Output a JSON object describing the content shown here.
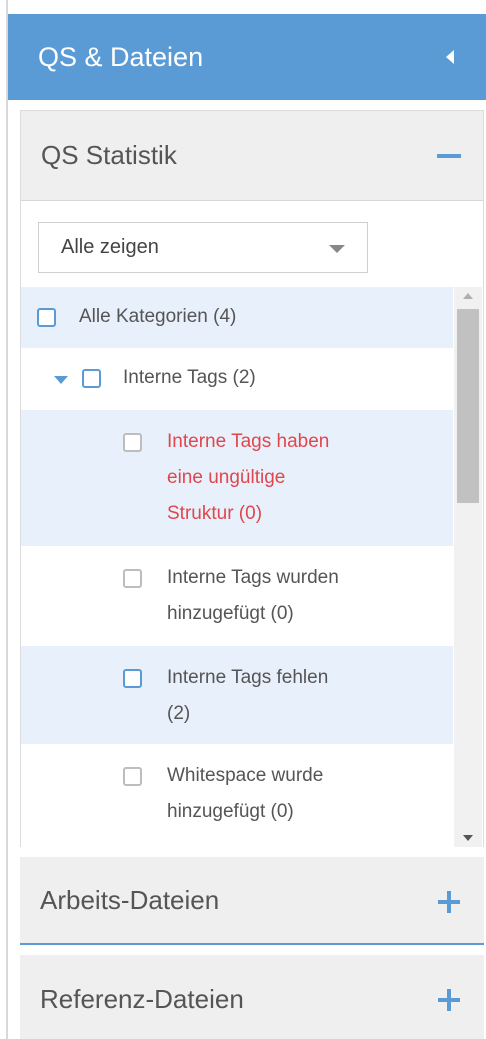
{
  "header": {
    "title": "QS & Dateien"
  },
  "qs_statistik": {
    "title": "QS Statistik",
    "filter": {
      "selected": "Alle zeigen"
    },
    "tree": {
      "root": {
        "label": "Alle Kategorien (4)"
      },
      "group": {
        "label": "Interne Tags (2)"
      },
      "children": [
        {
          "line1": "Interne Tags haben",
          "line2": "eine ungültige",
          "line3": "Struktur (0)"
        },
        {
          "line1": "Interne Tags wurden",
          "line2": "hinzugefügt (0)"
        },
        {
          "line1": "Interne Tags fehlen",
          "line2": "(2)"
        },
        {
          "line1": "Whitespace wurde",
          "line2": "hinzugefügt (0)"
        }
      ]
    }
  },
  "sections": {
    "arbeits": {
      "title": "Arbeits-Dateien"
    },
    "referenz": {
      "title": "Referenz-Dateien"
    }
  },
  "colors": {
    "accent": "#5b9bd5",
    "error": "#e0474c",
    "highlight": "#e8f0fb"
  }
}
